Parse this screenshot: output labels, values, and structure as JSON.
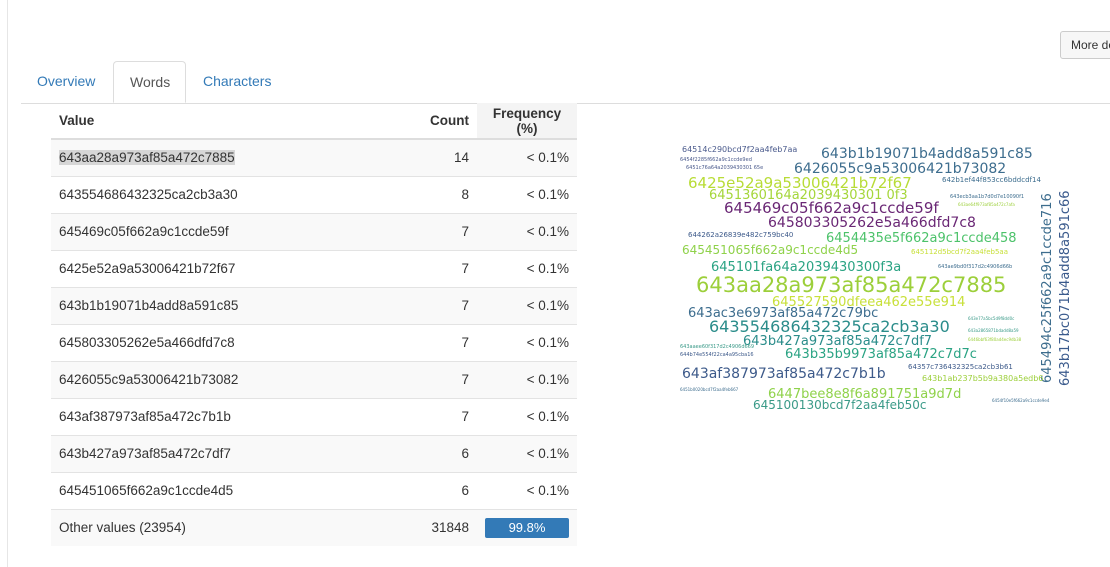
{
  "toolbar": {
    "more_label": "More de"
  },
  "tabs": [
    {
      "label": "Overview",
      "active": false
    },
    {
      "label": "Words",
      "active": true
    },
    {
      "label": "Characters",
      "active": false
    }
  ],
  "table": {
    "headers": {
      "value": "Value",
      "count": "Count",
      "frequency": "Frequency (%)"
    },
    "rows": [
      {
        "value": "643aa28a973af85a472c7885",
        "count": "14",
        "frequency": "< 0.1%"
      },
      {
        "value": "643554686432325ca2cb3a30",
        "count": "8",
        "frequency": "< 0.1%"
      },
      {
        "value": "645469c05f662a9c1ccde59f",
        "count": "7",
        "frequency": "< 0.1%"
      },
      {
        "value": "6425e52a9a53006421b72f67",
        "count": "7",
        "frequency": "< 0.1%"
      },
      {
        "value": "643b1b19071b4add8a591c85",
        "count": "7",
        "frequency": "< 0.1%"
      },
      {
        "value": "645803305262e5a466dfd7c8",
        "count": "7",
        "frequency": "< 0.1%"
      },
      {
        "value": "6426055c9a53006421b73082",
        "count": "7",
        "frequency": "< 0.1%"
      },
      {
        "value": "643af387973af85a472c7b1b",
        "count": "7",
        "frequency": "< 0.1%"
      },
      {
        "value": "643b427a973af85a472c7df7",
        "count": "6",
        "frequency": "< 0.1%"
      },
      {
        "value": "645451065f662a9c1ccde4d5",
        "count": "6",
        "frequency": "< 0.1%"
      }
    ],
    "other": {
      "value": "Other values (23954)",
      "count": "31848",
      "frequency": "99.8%",
      "frequency_fraction": 0.998
    }
  },
  "wordcloud": {
    "words": [
      {
        "text": "643aa28a973af85a472c7885",
        "color": "#9ccf3a"
      },
      {
        "text": "643554686432325ca2cb3a30",
        "color": "#2a8c8a"
      },
      {
        "text": "645469c05f662a9c1ccde59f",
        "color": "#6a2775"
      },
      {
        "text": "6425e52a9a53006421b72f67",
        "color": "#b8dc36"
      },
      {
        "text": "643b1b19071b4add8a591c85",
        "color": "#3d6d8e"
      },
      {
        "text": "645803305262e5a466dfd7c8",
        "color": "#6a2775"
      },
      {
        "text": "6426055c9a53006421b73082",
        "color": "#3d6d8e"
      },
      {
        "text": "643af387973af85a472c7b1b",
        "color": "#3d5a8a"
      },
      {
        "text": "643b427a973af85a472c7df7",
        "color": "#2a8c8a"
      },
      {
        "text": "645451065f662a9c1ccde4d5",
        "color": "#8fd24a"
      },
      {
        "text": "6451360164a2039430301 0f3",
        "color": "#a5d63a"
      },
      {
        "text": "645101fa64a2039430300f3a",
        "color": "#2aa383"
      },
      {
        "text": "6454435e5f662a9c1ccde458",
        "color": "#4cc26a"
      },
      {
        "text": "645527590dfeea462e55e914",
        "color": "#c8e03a"
      },
      {
        "text": "643ac3e6973af85a472c79bc",
        "color": "#3d6d8e"
      },
      {
        "text": "643b35b9973af85a472c7d7c",
        "color": "#2aa383"
      },
      {
        "text": "6447bee8e8f6a891751a9d7d",
        "color": "#8fd24a"
      },
      {
        "text": "645100130bcd7f2aa4feb50c",
        "color": "#3a9a88"
      },
      {
        "text": "645494c25f662a9c1ccde716",
        "color": "#3d6d8e"
      },
      {
        "text": "643b17bc071b4add8a591c66",
        "color": "#3a5a8c"
      },
      {
        "text": "64514c290bcd7f2aa4feb7aa",
        "color": "#4a5a8c"
      },
      {
        "text": "642b1ef44f853cc6bddcdf14",
        "color": "#3d6d8e"
      },
      {
        "text": "645112d5bcd7f2aa4feb5aa",
        "color": "#c8e03a"
      },
      {
        "text": "644262a26839e482c759bc40",
        "color": "#3d5a8a"
      },
      {
        "text": "64357c736432325ca2cb3b61",
        "color": "#3d5a8a"
      },
      {
        "text": "643b1ab237b5b9a380a5edb6",
        "color": "#9ccf3a"
      },
      {
        "text": "6454f2285f662a9c1ccde9ed",
        "color": "#4a5a8c"
      },
      {
        "text": "6451c76a64a2039430301 65e",
        "color": "#4a5a8c"
      },
      {
        "text": "643ecb3aa1b7d0d7e10090f1",
        "color": "#3d6d8e"
      },
      {
        "text": "643ae9bd0f317d2c4906d66b",
        "color": "#3d6d8e"
      },
      {
        "text": "643aaee60f317d2c4906d669",
        "color": "#3a9a88"
      },
      {
        "text": "644b74e554f22ca4a95cba16",
        "color": "#3d5a8a"
      },
      {
        "text": "6451b0020bcd7f2aa4feb667",
        "color": "#3d6d8e"
      },
      {
        "text": "6454f10e5f662a9c1ccde9e4",
        "color": "#3d6d8e"
      },
      {
        "text": "643ae64f973af85a472c7afa",
        "color": "#9ccf3a"
      },
      {
        "text": "643a2865871bdadd8a59",
        "color": "#3a9a88"
      },
      {
        "text": "643e77a5bc5d9f8dd0c",
        "color": "#3a9a88"
      },
      {
        "text": "6446bbf63f80ad4ec9db38",
        "color": "#9ccf3a"
      }
    ]
  }
}
